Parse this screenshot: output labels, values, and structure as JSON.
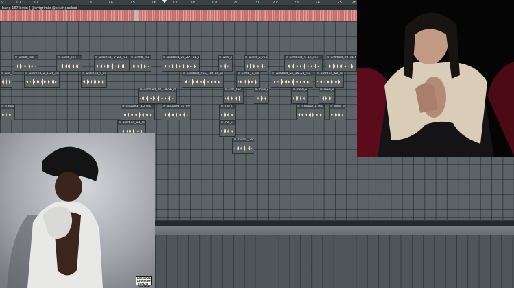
{
  "ruler": {
    "ticks": [
      {
        "label": "9",
        "at": 0.0
      },
      {
        "label": "10",
        "at": 0.04
      },
      {
        "label": "11",
        "at": 0.09
      },
      {
        "label": "13",
        "at": 0.24
      },
      {
        "label": "14",
        "at": 0.3
      },
      {
        "label": "15",
        "at": 0.36
      },
      {
        "label": "16",
        "at": 0.42
      },
      {
        "label": "17",
        "at": 0.48
      },
      {
        "label": "18",
        "at": 0.53
      },
      {
        "label": "19",
        "at": 0.59
      },
      {
        "label": "20",
        "at": 0.65
      },
      {
        "label": "21",
        "at": 0.71
      },
      {
        "label": "22",
        "at": 0.76
      },
      {
        "label": "23",
        "at": 0.82
      },
      {
        "label": "24",
        "at": 0.88
      },
      {
        "label": "25",
        "at": 0.94
      },
      {
        "label": "26",
        "at": 0.99
      }
    ],
    "playhead_fraction": 0.46
  },
  "project": {
    "title": "bang 167 bmin [ @ovigrimix @elijahgeeked ]"
  },
  "clips": [
    {
      "label": "⊪ untitl_rec",
      "wave": true
    },
    {
      "label": "⊪ untitl_rec",
      "wave": true
    },
    {
      "label": "⊪ untitled_-7-23_rec",
      "wave": true
    },
    {
      "label": "⊪ untitl_rec",
      "wave": true
    },
    {
      "label": "⊪ untitled_20_37--31_rec",
      "wave": true
    },
    {
      "label": "⊪ unti_ec",
      "wave": true
    },
    {
      "label": "⊪ untitl_2_rec",
      "wave": true
    },
    {
      "label": "⊪ untitled_-9-12_rec",
      "wave": true
    },
    {
      "label": "⊪ untitled_20-21-59",
      "wave": true
    },
    {
      "label": "⊪ unt_ec",
      "wave": true
    },
    {
      "label": "⊪ untitled_2_1-26_rec",
      "wave": true
    },
    {
      "label": "⊪ untitled_9_rec",
      "wave": true
    },
    {
      "label": "⊪ untitled_202_-38-38_rec",
      "wave": true
    },
    {
      "label": "⊪ untitl_6_rec",
      "wave": true
    },
    {
      "label": "⊪ untitled_28_15-21_rec",
      "wave": true
    },
    {
      "label": "⊪ untitled_50_rec",
      "wave": true
    },
    {
      "label": "⊪ untitled_20_38-56_rec",
      "wave": true
    },
    {
      "label": "⊪ unti_rec",
      "wave": true
    },
    {
      "label": "⊪ med_ec",
      "wave": true
    },
    {
      "label": "⊪ med_ec",
      "wave": true
    },
    {
      "label": "⊪ med_ec",
      "wave": true
    },
    {
      "label": "⊪ media_ec",
      "wave": true
    },
    {
      "label": "⊪ untitled_-10_rec",
      "wave": true
    },
    {
      "label": "⊪ untitled_30_rec",
      "wave": true
    },
    {
      "label": "⊪ me_c",
      "wave": true
    },
    {
      "label": "⊪ medula_1_rec",
      "wave": true
    },
    {
      "label": "⊪ med_ec",
      "wave": true
    },
    {
      "label": "⊪ untitled_13_rec",
      "wave": true
    },
    {
      "label": "⊪ me_c",
      "wave": true
    },
    {
      "label": "⊪ medul_rec",
      "wave": true
    },
    {
      "label": "⊪ medula_202_26-56_rec",
      "wave": true
    }
  ],
  "cover_badge": {
    "line1": "PARENTAL",
    "line2": "ADVISORY",
    "line3": "EXPLICIT CONTENT"
  }
}
